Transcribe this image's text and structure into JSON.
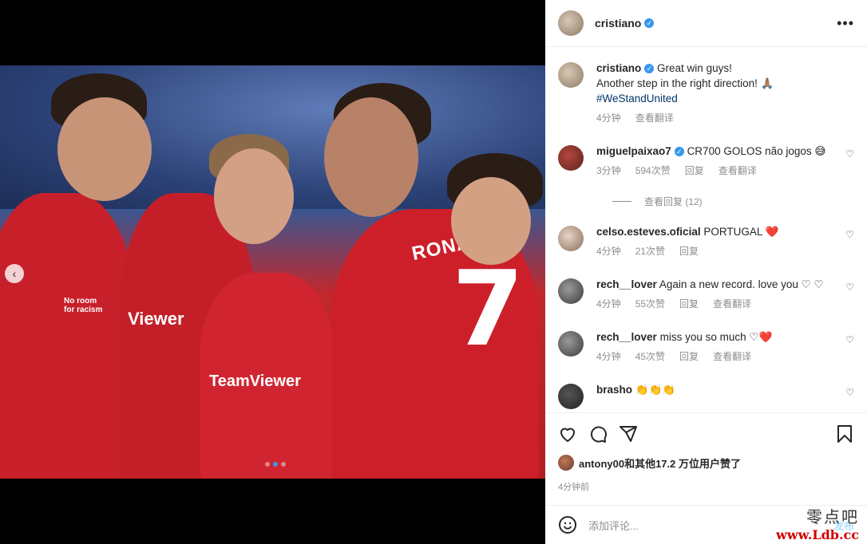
{
  "post": {
    "author": "cristiano",
    "caption_line1": "Great win guys!",
    "caption_line2": "Another step in the right direction! 🙏🏽",
    "hashtag": "#WeStandUnited",
    "caption_time": "4分钟",
    "caption_translate": "查看翻译"
  },
  "photo": {
    "jersey_name": "RONALDO",
    "jersey_number": "7",
    "sponsor": "TeamViewer",
    "sponsor2": "Viewer",
    "sleeve": "No room for racism"
  },
  "comments": [
    {
      "user": "miguelpaixao7",
      "verified": true,
      "text": "CR700 GOLOS não jogos 😅",
      "time": "3分钟",
      "likes": "594次赞",
      "reply": "回复",
      "translate": "查看翻译",
      "view_replies": "查看回复 (12)"
    },
    {
      "user": "celso.esteves.oficial",
      "verified": false,
      "text": "PORTUGAL ❤️",
      "time": "4分钟",
      "likes": "21次赞",
      "reply": "回复"
    },
    {
      "user": "rech__lover",
      "verified": false,
      "text": "Again a new record. love you ♡ ♡",
      "time": "4分钟",
      "likes": "55次赞",
      "reply": "回复",
      "translate": "查看翻译"
    },
    {
      "user": "rech__lover",
      "verified": false,
      "text": "miss you so much ♡❤️",
      "time": "4分钟",
      "likes": "45次赞",
      "reply": "回复",
      "translate": "查看翻译"
    },
    {
      "user": "brasho",
      "verified": false,
      "text": "👏👏👏"
    }
  ],
  "likes_text": "antony00和其他17.2 万位用户赞了",
  "post_time": "4分钟前",
  "add_comment_placeholder": "添加评论...",
  "post_button": "发布",
  "watermark_line1": "零点吧",
  "watermark_line2": "www.Ldb.cc",
  "icons": [
    "chevron-left-icon",
    "more-icon",
    "verified-icon",
    "heart-icon",
    "comment-icon",
    "share-icon",
    "bookmark-icon",
    "emoji-icon"
  ],
  "colors": {
    "accent": "#3897f0",
    "kit_red": "#c8202a",
    "muted": "#8e8e8e"
  }
}
